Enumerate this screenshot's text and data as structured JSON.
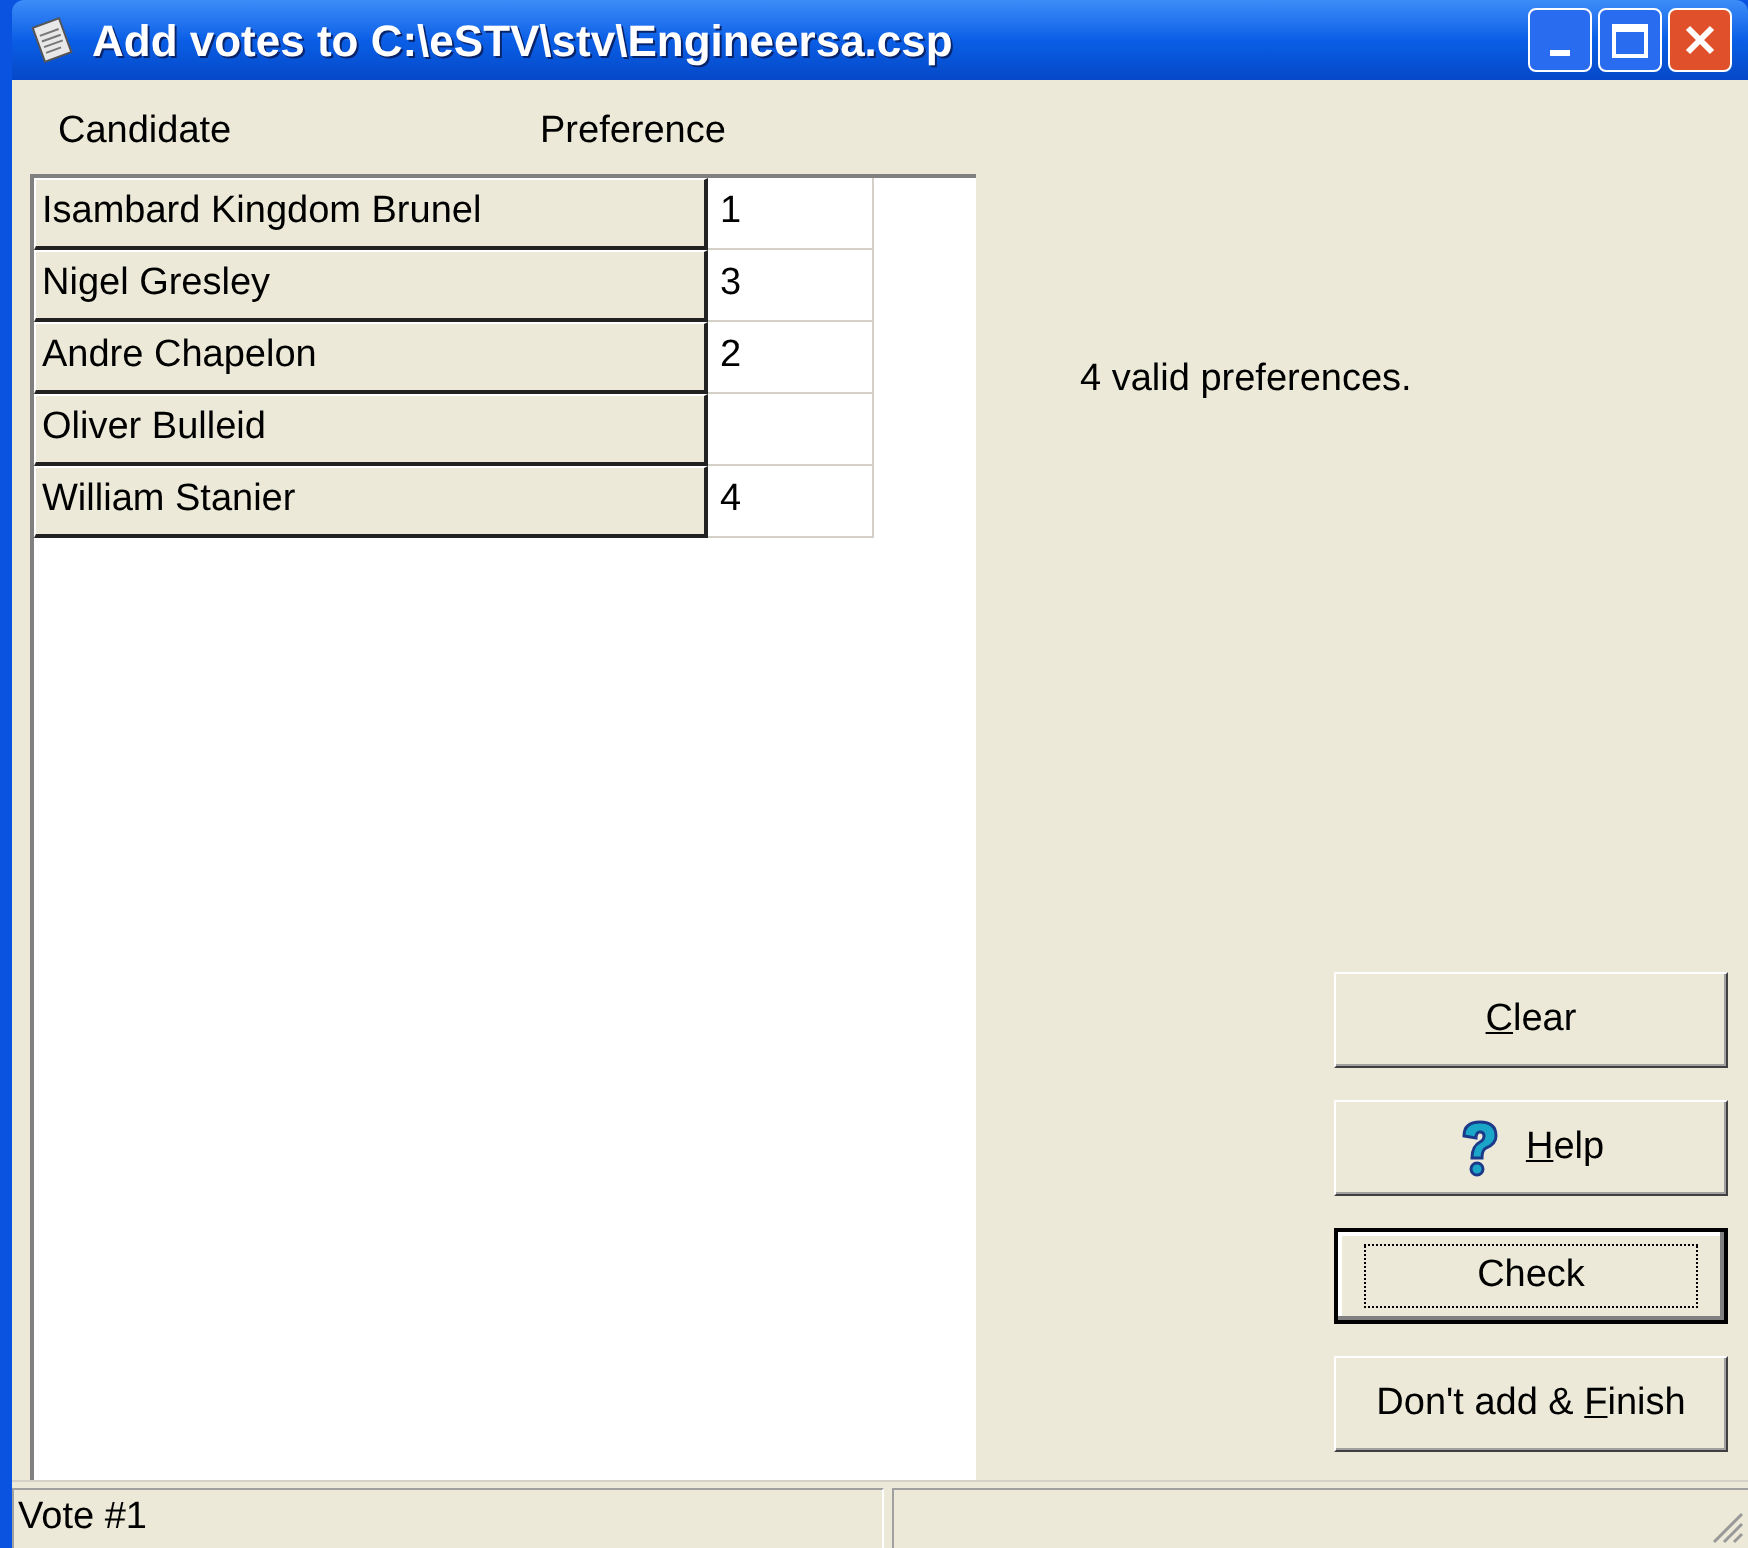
{
  "window": {
    "title": "Add votes to C:\\eSTV\\stv\\Engineersa.csp"
  },
  "table": {
    "columns": [
      "Candidate",
      "Preference"
    ],
    "rows": [
      {
        "candidate": "Isambard Kingdom Brunel",
        "preference": "1"
      },
      {
        "candidate": "Nigel Gresley",
        "preference": "3"
      },
      {
        "candidate": "Andre Chapelon",
        "preference": "2"
      },
      {
        "candidate": "Oliver Bulleid"
      },
      {
        "candidate": "William Stanier",
        "preference": "4"
      }
    ]
  },
  "message": "4 valid preferences.",
  "buttons": [
    {
      "kind": "plain",
      "key": "C",
      "after": "lear",
      "focused": false
    },
    {
      "kind": "help",
      "key": "H",
      "after": "elp",
      "focused": false
    },
    {
      "kind": "plain",
      "before": "Check",
      "focused": true
    },
    {
      "kind": "plain",
      "before": "Don't add & ",
      "key": "F",
      "after": "inish",
      "focused": false
    }
  ],
  "status_bar": {
    "text": "Vote #1"
  }
}
